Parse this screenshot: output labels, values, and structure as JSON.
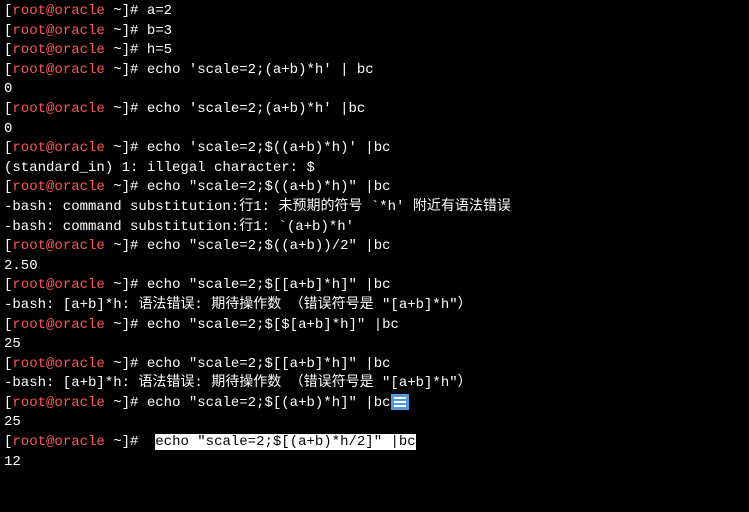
{
  "prompt": {
    "open": "[",
    "userhost": "root@oracle",
    "tilde": " ~",
    "close": "]# "
  },
  "lines": [
    {
      "type": "prompt",
      "cmd": "a=2"
    },
    {
      "type": "prompt",
      "cmd": "b=3"
    },
    {
      "type": "prompt",
      "cmd": "h=5"
    },
    {
      "type": "prompt",
      "cmd": "echo 'scale=2;(a+b)*h' | bc"
    },
    {
      "type": "output",
      "text": "0"
    },
    {
      "type": "prompt",
      "cmd": "echo 'scale=2;(a+b)*h' |bc"
    },
    {
      "type": "output",
      "text": "0"
    },
    {
      "type": "prompt",
      "cmd": "echo 'scale=2;$((a+b)*h)' |bc"
    },
    {
      "type": "output",
      "text": "(standard_in) 1: illegal character: $"
    },
    {
      "type": "prompt",
      "cmd": "echo \"scale=2;$((a+b)*h)\" |bc"
    },
    {
      "type": "output",
      "text": "-bash: command substitution:行1: 未预期的符号 `*h' 附近有语法错误"
    },
    {
      "type": "output",
      "text": "-bash: command substitution:行1: `(a+b)*h'"
    },
    {
      "type": "prompt",
      "cmd": "echo \"scale=2;$((a+b))/2\" |bc"
    },
    {
      "type": "output",
      "text": "2.50"
    },
    {
      "type": "prompt",
      "cmd": "echo \"scale=2;$[[a+b]*h]\" |bc"
    },
    {
      "type": "output",
      "text": "-bash: [a+b]*h: 语法错误: 期待操作数 （错误符号是 \"[a+b]*h\"）"
    },
    {
      "type": "prompt",
      "cmd": "echo \"scale=2;$[$[a+b]*h]\" |bc"
    },
    {
      "type": "output",
      "text": "25"
    },
    {
      "type": "prompt",
      "cmd": "echo \"scale=2;$[[a+b]*h]\" |bc"
    },
    {
      "type": "output",
      "text": "-bash: [a+b]*h: 语法错误: 期待操作数 （错误符号是 \"[a+b]*h\"）"
    },
    {
      "type": "prompt-badge",
      "cmd": "echo \"scale=2;$[(a+b)*h]\" |bc"
    },
    {
      "type": "output",
      "text": "25"
    },
    {
      "type": "prompt-highlight",
      "pre": " ",
      "hl": "echo \"scale=2;$[(a+b)*h/2]\" |bc"
    },
    {
      "type": "output",
      "text": "12"
    }
  ]
}
